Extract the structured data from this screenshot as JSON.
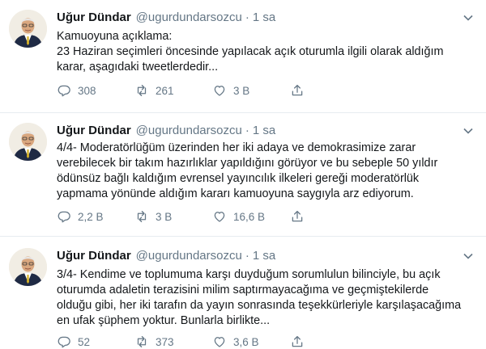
{
  "tweets": [
    {
      "author": "Uğur Dündar",
      "handle": "@ugurdundarsozcu",
      "separator": "·",
      "time": "1 sa",
      "lines": [
        "Kamuoyuna açıklama:",
        "23 Haziran seçimleri öncesinde yapılacak açık oturumla ilgili olarak aldığım",
        "karar, aşagıdaki tweetlerdedir..."
      ],
      "replies": "308",
      "retweets": "261",
      "likes": "3 B"
    },
    {
      "author": "Uğur Dündar",
      "handle": "@ugurdundarsozcu",
      "separator": "·",
      "time": "1 sa",
      "lines": [
        "4/4- Moderatörlüğüm üzerinden her iki adaya ve demokrasimize zarar",
        "verebilecek bir takım hazırlıklar yapıldığını görüyor ve bu sebeple 50 yıldır",
        "ödünsüz bağlı kaldığım evrensel yayıncılık ilkeleri gereği moderatörlük",
        "yapmama yönünde aldığım kararı kamuoyuna saygıyla arz ediyorum."
      ],
      "replies": "2,2 B",
      "retweets": "3 B",
      "likes": "16,6 B"
    },
    {
      "author": "Uğur Dündar",
      "handle": "@ugurdundarsozcu",
      "separator": "·",
      "time": "1 sa",
      "lines": [
        "3/4- Kendime ve toplumuma karşı duyduğum sorumlulun bilinciyle, bu açık",
        "oturumda adaletin terazisini milim saptırmayacağıma ve geçmiştekilerde",
        "olduğu gibi, her iki tarafın da yayın sonrasında teşekkürleriyle karşılaşacağıma",
        "en ufak şüphem yoktur. Bunlarla birlikte..."
      ],
      "replies": "52",
      "retweets": "373",
      "likes": "3,6 B"
    }
  ],
  "icons": {
    "reply": "reply-icon",
    "retweet": "retweet-icon",
    "like": "heart-icon",
    "share": "share-icon",
    "caret": "chevron-down-icon"
  },
  "colors": {
    "text": "#14171a",
    "muted": "#657786",
    "divider": "#e6ecf0"
  }
}
